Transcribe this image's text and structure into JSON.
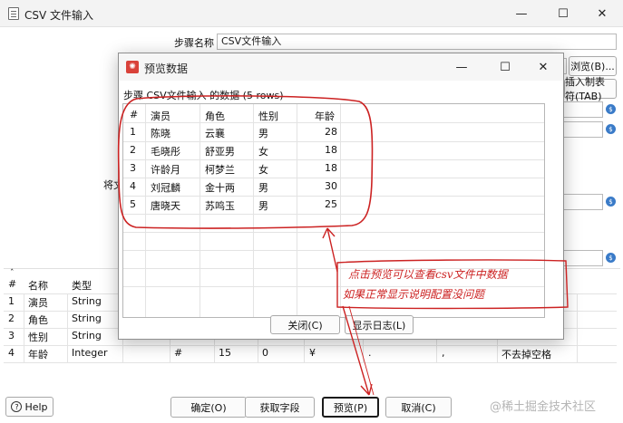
{
  "main": {
    "title": "CSV 文件输入",
    "step_name_label": "步骤名称",
    "step_name_value": "CSV文件输入",
    "browse_label": "浏览(B)...",
    "tab_delimiter_label": "插入制表符(TAB)",
    "side_label": "将文",
    "fields_table": {
      "columns": [
        "#",
        "名称",
        "类型"
      ],
      "rows": [
        {
          "n": "1",
          "name": "演员",
          "type": "String"
        },
        {
          "n": "2",
          "name": "角色",
          "type": "String"
        },
        {
          "n": "3",
          "name": "性别",
          "type": "String"
        },
        {
          "n": "4",
          "name": "年龄",
          "type": "Integer",
          "format": "#",
          "length": "15",
          "precision": "0",
          "currency": "¥",
          "decimal": ".",
          "group": ",",
          "trim": "不去掉空格"
        }
      ]
    },
    "buttons": {
      "help": "Help",
      "ok": "确定(O)",
      "get_fields": "获取字段",
      "preview": "预览(P)",
      "cancel": "取消(C)"
    }
  },
  "dialog": {
    "title": "预览数据",
    "subtitle": "步骤 CSV文件输入 的数据  (5 rows)",
    "columns": [
      "#",
      "演员",
      "角色",
      "性别",
      "年龄"
    ],
    "rows": [
      [
        "1",
        "陈晓",
        "云襄",
        "男",
        "28"
      ],
      [
        "2",
        "毛晓彤",
        "舒亚男",
        "女",
        "18"
      ],
      [
        "3",
        "许龄月",
        "柯梦兰",
        "女",
        "18"
      ],
      [
        "4",
        "刘冠麟",
        "金十两",
        "男",
        "30"
      ],
      [
        "5",
        "唐晓天",
        "苏鸣玉",
        "男",
        "25"
      ]
    ],
    "close_label": "关闭(C)",
    "show_log_label": "显示日志(L)"
  },
  "annotation": {
    "line1": "点击预览可以查看csv文件中数据",
    "line2": "如果正常显示说明配置没问题",
    "color": "#cc2222"
  },
  "watermark": "@稀土掘金技术社区",
  "icons": {
    "app": "document-icon",
    "dialog": "spoon-icon",
    "variable": "variable-diamond-icon",
    "help": "help-icon"
  }
}
